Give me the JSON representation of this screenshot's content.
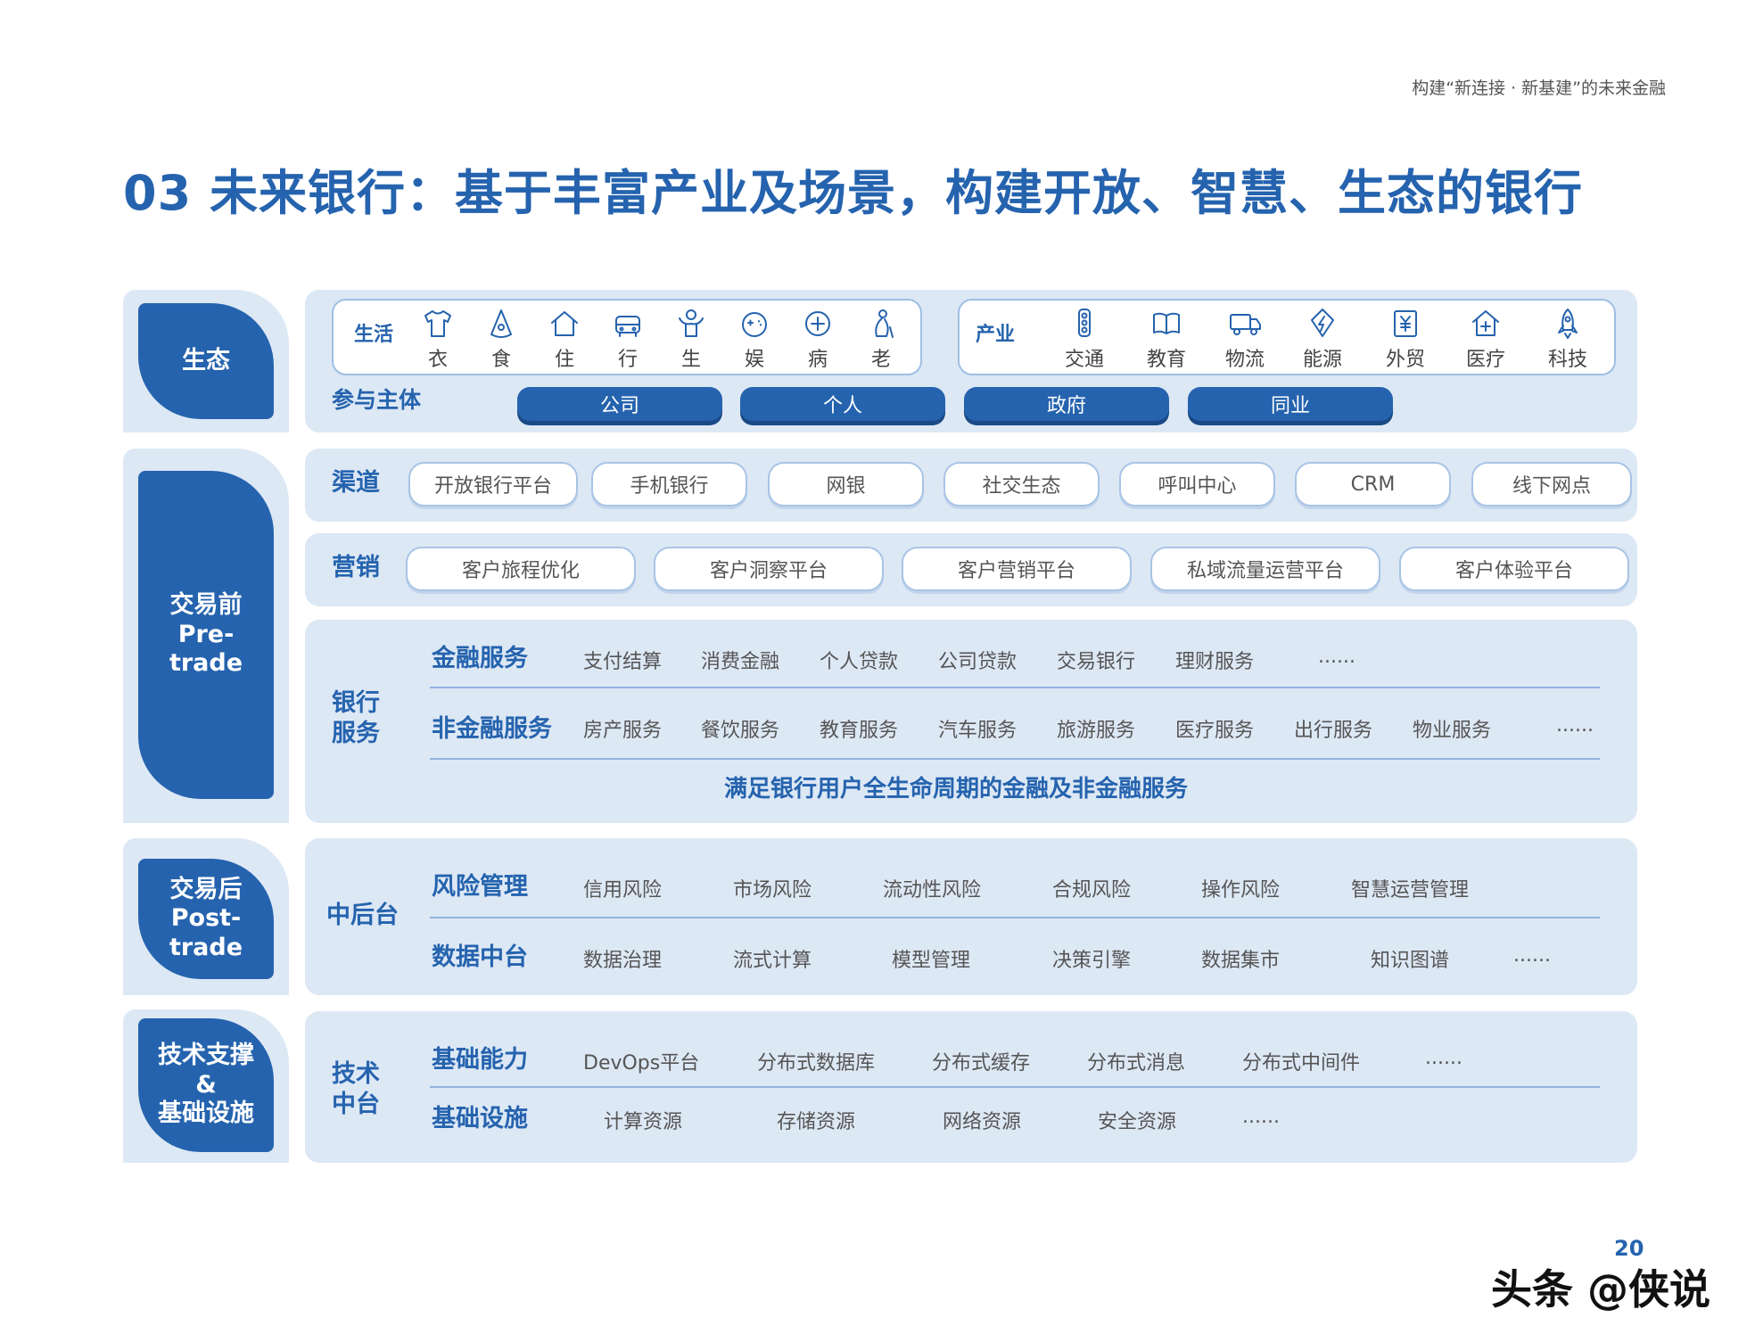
{
  "header": {
    "tag": "构建“新连接 · 新基建”的未来金融"
  },
  "title": "03 未来银行：基于丰富产业及场景，构建开放、智慧、生态的银行",
  "ecosystem": {
    "tab": "生态",
    "life": {
      "label": "生活",
      "items": [
        "衣",
        "食",
        "住",
        "行",
        "生",
        "娱",
        "病",
        "老"
      ]
    },
    "industry": {
      "label": "产业",
      "items": [
        "交通",
        "教育",
        "物流",
        "能源",
        "外贸",
        "医疗",
        "科技"
      ]
    },
    "participants": {
      "label": "参与主体",
      "items": [
        "公司",
        "个人",
        "政府",
        "同业"
      ]
    }
  },
  "pretrade": {
    "tab": "交易前\nPre-\ntrade",
    "channels": {
      "label": "渠道",
      "items": [
        "开放银行平台",
        "手机银行",
        "网银",
        "社交生态",
        "呼叫中心",
        "CRM",
        "线下网点"
      ]
    },
    "marketing": {
      "label": "营销",
      "items": [
        "客户旅程优化",
        "客户洞察平台",
        "客户营销平台",
        "私域流量运营平台",
        "客户体验平台"
      ]
    },
    "bank_services": {
      "label": "银行\n服务",
      "financial": {
        "label": "金融服务",
        "items": [
          "支付结算",
          "消费金融",
          "个人贷款",
          "公司贷款",
          "交易银行",
          "理财服务",
          "......"
        ]
      },
      "nonfinancial": {
        "label": "非金融服务",
        "items": [
          "房产服务",
          "餐饮服务",
          "教育服务",
          "汽车服务",
          "旅游服务",
          "医疗服务",
          "出行服务",
          "物业服务",
          "......"
        ]
      },
      "note": "满足银行用户全生命周期的金融及非金融服务"
    }
  },
  "posttrade": {
    "tab": "交易后\nPost-\ntrade",
    "label": "中后台",
    "risk": {
      "label": "风险管理",
      "items": [
        "信用风险",
        "市场风险",
        "流动性风险",
        "合规风险",
        "操作风险",
        "智慧运营管理"
      ]
    },
    "data": {
      "label": "数据中台",
      "items": [
        "数据治理",
        "流式计算",
        "模型管理",
        "决策引擎",
        "数据集市",
        "知识图谱",
        "......"
      ]
    }
  },
  "tech": {
    "tab": "技术支撑\n&\n基础设施",
    "label": "技术\n中台",
    "capability": {
      "label": "基础能力",
      "items": [
        "DevOps平台",
        "分布式数据库",
        "分布式缓存",
        "分布式消息",
        "分布式中间件",
        "......"
      ]
    },
    "infra": {
      "label": "基础设施",
      "items": [
        "计算资源",
        "存储资源",
        "网络资源",
        "安全资源",
        "......"
      ]
    }
  },
  "page_number": "20",
  "watermark": "头条 @侠说",
  "colors": {
    "accent": "#2563ae",
    "band": "#dde8f5",
    "pill_border": "#a8c4e5"
  }
}
